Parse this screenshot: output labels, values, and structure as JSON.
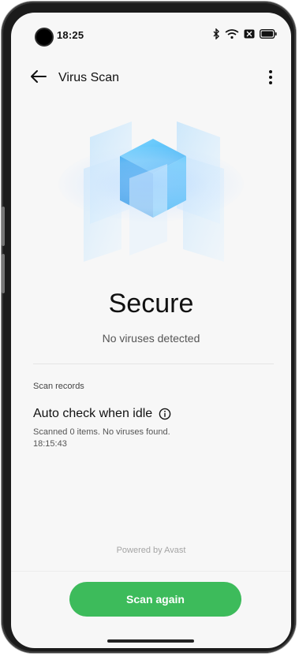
{
  "status_bar": {
    "time": "18:25"
  },
  "toolbar": {
    "title": "Virus Scan"
  },
  "status": {
    "title": "Secure",
    "subtitle": "No viruses detected"
  },
  "records": {
    "section_label": "Scan records",
    "items": [
      {
        "title": "Auto check when idle",
        "description": "Scanned 0 items. No viruses found.",
        "time": "18:15:43"
      }
    ]
  },
  "footer": {
    "powered_by": "Powered by Avast"
  },
  "actions": {
    "scan_again": "Scan again"
  },
  "colors": {
    "accent_green": "#3dbb5b",
    "shield_blue": "#2ea6f2"
  },
  "icons": [
    "back-arrow-icon",
    "more-options-icon",
    "info-icon",
    "bluetooth-icon",
    "wifi-icon",
    "battery-icon"
  ]
}
